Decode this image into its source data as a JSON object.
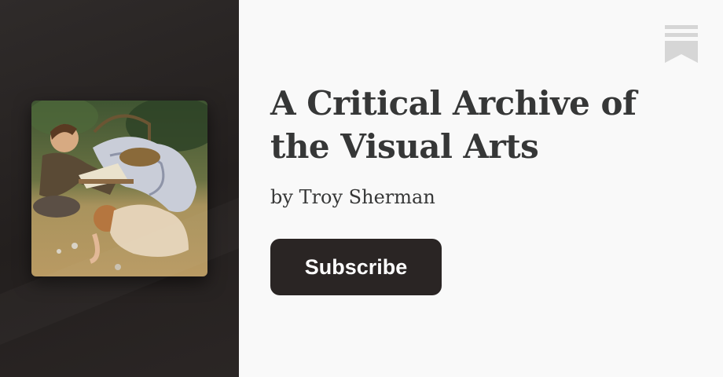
{
  "publication": {
    "title": "A Critical Archive of the Visual Arts",
    "byline_prefix": "by",
    "author": "Troy Sherman"
  },
  "actions": {
    "subscribe_label": "Subscribe"
  },
  "icons": {
    "bookmark": "bookmark-icon",
    "cover": "painting-cover"
  },
  "colors": {
    "left_panel": "#231f1e",
    "page_background": "#f9f9f9",
    "title_text": "#363737",
    "button_background": "#2a2524",
    "button_text": "#ffffff",
    "bookmark_icon": "#d6d6d6"
  }
}
